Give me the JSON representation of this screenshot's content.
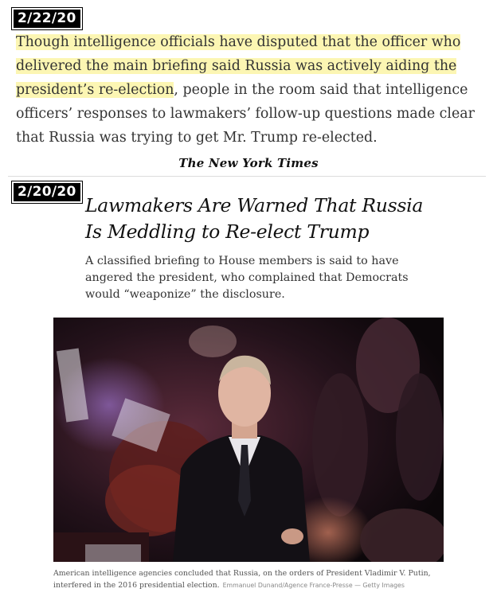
{
  "update_section": {
    "date": "2/22/20",
    "highlighted_text": "Though intelligence officials have disputed that the officer who delivered the main briefing said Russia was actively aiding the president’s re-election",
    "rest_text": ", people in the room said that intelligence officers’ responses to lawmakers’ follow-up questions made clear that Russia was trying to get Mr. Trump re-elected.",
    "publisher": "The New York Times"
  },
  "article": {
    "date": "2/20/20",
    "headline_line1": "Lawmakers Are Warned That Russia",
    "headline_line2": "Is Meddling to Re-elect Trump",
    "dek": "A classified briefing to House members is said to have angered the president, who complained that Democrats would “weaponize” the disclosure.",
    "caption": "American intelligence agencies concluded that Russia, on the orders of President Vladimir V. Putin, interfered in the 2016 presidential election.",
    "credit": "Emmanuel Dunand/Agence France-Presse — Getty Images"
  },
  "colors": {
    "highlight": "#fcf6b3",
    "badge_bg": "#000000",
    "photo_bg": "#1a0f14"
  }
}
